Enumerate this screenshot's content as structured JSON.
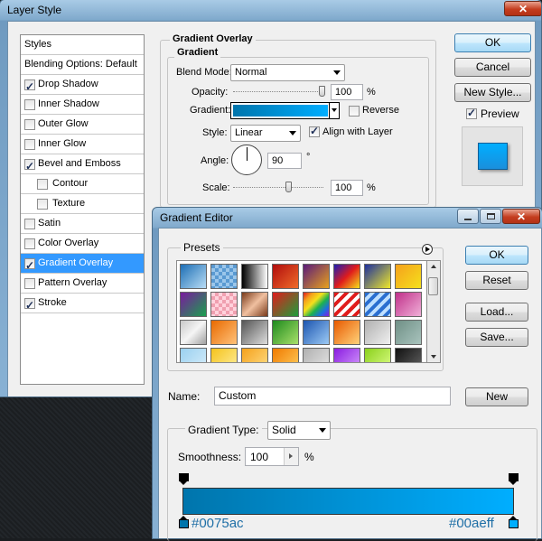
{
  "layer_style": {
    "title": "Layer Style",
    "list": [
      {
        "label": "Styles",
        "header": true
      },
      {
        "label": "Blending Options: Default",
        "header": true
      },
      {
        "label": "Drop Shadow",
        "checked": true
      },
      {
        "label": "Inner Shadow",
        "checked": false
      },
      {
        "label": "Outer Glow",
        "checked": false
      },
      {
        "label": "Inner Glow",
        "checked": false
      },
      {
        "label": "Bevel and Emboss",
        "checked": true
      },
      {
        "label": "Contour",
        "checked": false,
        "indent": true
      },
      {
        "label": "Texture",
        "checked": false,
        "indent": true
      },
      {
        "label": "Satin",
        "checked": false
      },
      {
        "label": "Color Overlay",
        "checked": false
      },
      {
        "label": "Gradient Overlay",
        "checked": true,
        "selected": true
      },
      {
        "label": "Pattern Overlay",
        "checked": false
      },
      {
        "label": "Stroke",
        "checked": true
      }
    ],
    "panel": {
      "section_title": "Gradient Overlay",
      "subsection_title": "Gradient",
      "blend_mode_label": "Blend Mode:",
      "blend_mode_value": "Normal",
      "opacity_label": "Opacity:",
      "opacity_value": "100",
      "opacity_unit": "%",
      "gradient_label": "Gradient:",
      "reverse_label": "Reverse",
      "reverse_checked": false,
      "style_label": "Style:",
      "style_value": "Linear",
      "align_label": "Align with Layer",
      "align_checked": true,
      "angle_label": "Angle:",
      "angle_value": "90",
      "angle_unit": "°",
      "scale_label": "Scale:",
      "scale_value": "100",
      "scale_unit": "%"
    },
    "buttons": {
      "ok": "OK",
      "cancel": "Cancel",
      "new_style": "New Style...",
      "preview_label": "Preview",
      "preview_checked": true
    },
    "preview_color": "#1a8fdc"
  },
  "gradient_editor": {
    "title": "Gradient Editor",
    "presets_label": "Presets",
    "buttons": {
      "ok": "OK",
      "reset": "Reset",
      "load": "Load...",
      "save": "Save...",
      "new": "New"
    },
    "name_label": "Name:",
    "name_value": "Custom",
    "gradient_type_label": "Gradient Type:",
    "gradient_type_value": "Solid",
    "smoothness_label": "Smoothness:",
    "smoothness_value": "100",
    "smoothness_unit": "%",
    "stops": {
      "left_color": "#0075ac",
      "right_color": "#00aeff",
      "left_label": "#0075ac",
      "right_label": "#00aeff"
    },
    "presets": [
      "linear-gradient(135deg,#1d6fb5,#b8dcf5)",
      "repeating-conic-gradient(#9bc6ea 0 25%,#5a9ad2 0 50%) 0 0/8px 8px",
      "linear-gradient(90deg,#000,#fff)",
      "linear-gradient(135deg,#b10d0d,#ef6b2a)",
      "linear-gradient(135deg,#5a1a7a,#e8a11c)",
      "linear-gradient(135deg,#1c1cb3,#e01c1c,#f5e01c)",
      "linear-gradient(135deg,#1c2f9e,#f0e82a)",
      "linear-gradient(135deg,#f5a11c,#f5e01c)",
      "linear-gradient(135deg,#7a1a9e,#1aa04d)",
      "repeating-conic-gradient(#f0a0b0 0 25%,#ffd2dc 0 50%) 0 0/8px 8px",
      "linear-gradient(135deg,#7a3a1a,#f0c0a0,#7a3a1a)",
      "linear-gradient(135deg,#e01c1c,#1c9e3a)",
      "linear-gradient(135deg,#e01c1c,#f5a11c,#f5e01c,#1cb34d,#1c6fe0,#8a1ce0)",
      "repeating-linear-gradient(135deg,#e01c1c 0 4px,#fff 4px 8px)",
      "repeating-linear-gradient(135deg,#2a6fd0 0 4px,#bfe0ff 4px 8px)",
      "linear-gradient(135deg,#c0308a,#f0b0d8)",
      "linear-gradient(135deg,#c8c8c8,#f5f5f5,#a0a0a0)",
      "linear-gradient(135deg,#e86a00,#ffc27a)",
      "linear-gradient(135deg,#555,#ddd)",
      "linear-gradient(135deg,#1e8a1e,#a8e06a)",
      "linear-gradient(135deg,#1c55b0,#9ccaf5)",
      "linear-gradient(135deg,#e85a00,#ffd27a)",
      "linear-gradient(135deg,#b0b0b0,#f0f0f0)",
      "linear-gradient(135deg,#6f8f86,#a9c4bd)",
      "linear-gradient(135deg,#9ad0f0,#d8eefa)",
      "linear-gradient(135deg,#f5c21c,#fff0a0)",
      "linear-gradient(135deg,#f5a11c,#ffe08a)",
      "linear-gradient(135deg,#f07a00,#ffd060)",
      "linear-gradient(135deg,#b0b0b0,#e8e8e8)",
      "linear-gradient(135deg,#8a1ce0,#d8a0ff)",
      "linear-gradient(135deg,#8ad01c,#e0ff8a)",
      "linear-gradient(135deg,#111,#666)"
    ]
  }
}
